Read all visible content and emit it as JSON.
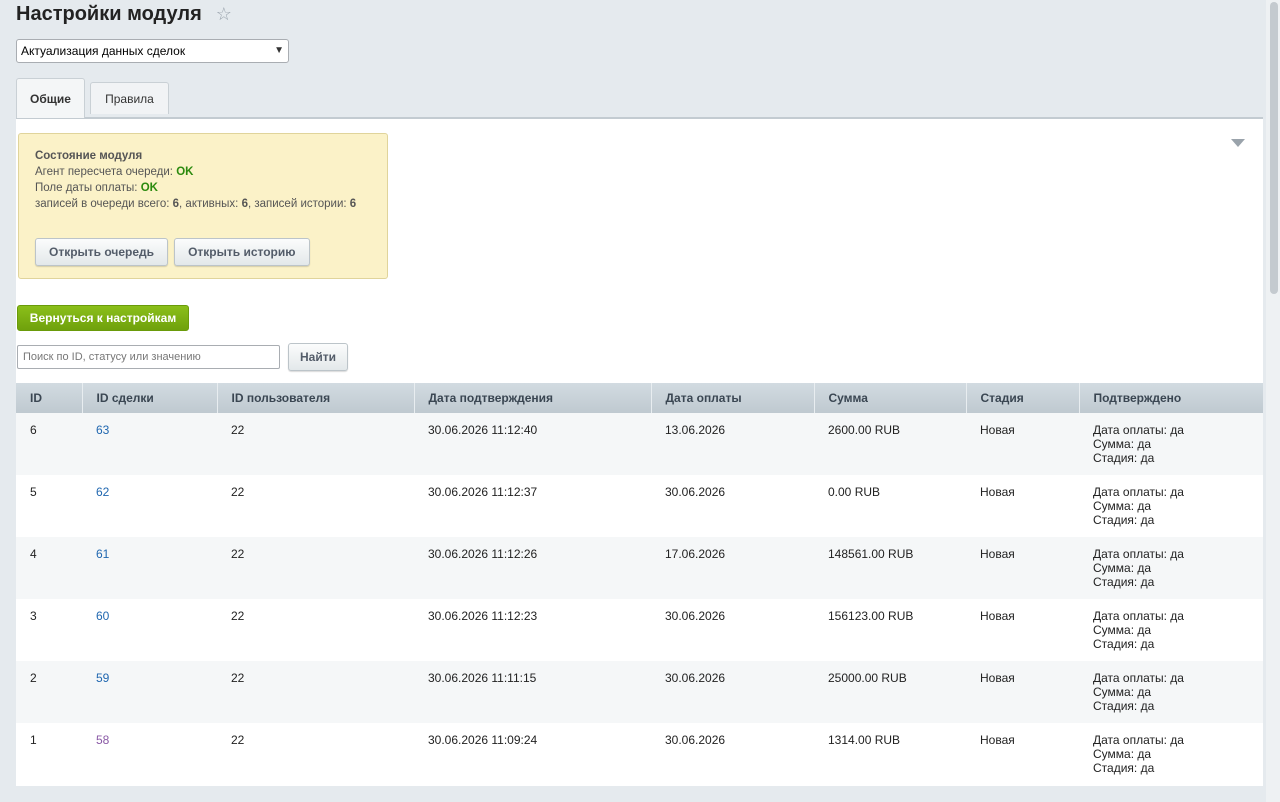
{
  "page": {
    "title": "Настройки модуля"
  },
  "module_select": {
    "value": "Актуализация данных сделок"
  },
  "tabs": [
    {
      "label": "Общие"
    },
    {
      "label": "Правила"
    }
  ],
  "status": {
    "title": "Состояние модуля",
    "agent_label": "Агент пересчета очереди: ",
    "agent_value": "OK",
    "field_label": "Поле даты оплаты: ",
    "field_value": "OK",
    "queue_prefix": "записей в очереди всего: ",
    "queue_total": "6",
    "active_prefix": ", активных: ",
    "queue_active": "6",
    "history_prefix": ", записей истории: ",
    "history_count": "6",
    "open_queue_label": "Открыть очередь",
    "open_history_label": "Открыть историю"
  },
  "back_button": {
    "label": "Вернуться к настройкам"
  },
  "search": {
    "placeholder": "Поиск по ID, статусу или значению",
    "value": "",
    "button_label": "Найти"
  },
  "table": {
    "headers": [
      "ID",
      "ID сделки",
      "ID пользователя",
      "Дата подтверждения",
      "Дата оплаты",
      "Сумма",
      "Стадия",
      "Подтверждено"
    ],
    "rows": [
      {
        "id": "6",
        "deal": "63",
        "user": "22",
        "confirmed_at": "30.06.2026 11:12:40",
        "paid_at": "13.06.2026",
        "sum": "2600.00 RUB",
        "stage": "Новая",
        "c1": "Дата оплаты: да",
        "c2": "Сумма: да",
        "c3": "Стадия: да"
      },
      {
        "id": "5",
        "deal": "62",
        "user": "22",
        "confirmed_at": "30.06.2026 11:12:37",
        "paid_at": "30.06.2026",
        "sum": "0.00 RUB",
        "stage": "Новая",
        "c1": "Дата оплаты: да",
        "c2": "Сумма: да",
        "c3": "Стадия: да"
      },
      {
        "id": "4",
        "deal": "61",
        "user": "22",
        "confirmed_at": "30.06.2026 11:12:26",
        "paid_at": "17.06.2026",
        "sum": "148561.00 RUB",
        "stage": "Новая",
        "c1": "Дата оплаты: да",
        "c2": "Сумма: да",
        "c3": "Стадия: да"
      },
      {
        "id": "3",
        "deal": "60",
        "user": "22",
        "confirmed_at": "30.06.2026 11:12:23",
        "paid_at": "30.06.2026",
        "sum": "156123.00 RUB",
        "stage": "Новая",
        "c1": "Дата оплаты: да",
        "c2": "Сумма: да",
        "c3": "Стадия: да"
      },
      {
        "id": "2",
        "deal": "59",
        "user": "22",
        "confirmed_at": "30.06.2026 11:11:15",
        "paid_at": "30.06.2026",
        "sum": "25000.00 RUB",
        "stage": "Новая",
        "c1": "Дата оплаты: да",
        "c2": "Сумма: да",
        "c3": "Стадия: да"
      },
      {
        "id": "1",
        "deal": "58",
        "user": "22",
        "confirmed_at": "30.06.2026 11:09:24",
        "paid_at": "30.06.2026",
        "sum": "1314.00 RUB",
        "stage": "Новая",
        "c1": "Дата оплаты: да",
        "c2": "Сумма: да",
        "c3": "Стадия: да"
      }
    ]
  },
  "colors": {
    "accent_green": "#7cb00f",
    "ok_green": "#2b8a0e",
    "link_blue": "#2067b0",
    "link_visited": "#8a5aa6",
    "status_bg": "#fbf2c8"
  },
  "icons": {
    "favorite": "star-icon",
    "select_arrow": "chevron-down-icon",
    "collapse": "triangle-down-icon"
  }
}
